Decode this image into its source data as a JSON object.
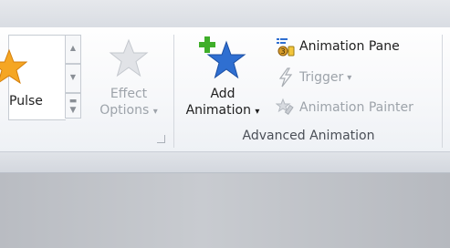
{
  "ribbon": {
    "gallery": {
      "selected_label": "Pulse",
      "icon": "pulse-star-icon"
    },
    "effect_options": {
      "label_line1": "Effect",
      "label_line2": "Options",
      "dropdown_glyph": "▾",
      "icon": "effect-options-star-icon",
      "enabled": false
    },
    "add_animation": {
      "label_line1": "Add",
      "label_line2": "Animation",
      "dropdown_glyph": "▾",
      "icon": "add-animation-star-icon",
      "enabled": true
    },
    "animation_pane": {
      "label": "Animation Pane",
      "icon": "animation-pane-icon",
      "enabled": true
    },
    "trigger": {
      "label": "Trigger",
      "dropdown_glyph": "▾",
      "icon": "trigger-lightning-icon",
      "enabled": false
    },
    "animation_painter": {
      "label": "Animation Painter",
      "icon": "animation-painter-icon",
      "enabled": false
    },
    "group_label": "Advanced Animation",
    "colors": {
      "star_orange": "#f5a623",
      "star_blue": "#2f6fd1",
      "plus_green": "#3fae29",
      "disabled_text": "#9da3aa"
    }
  }
}
